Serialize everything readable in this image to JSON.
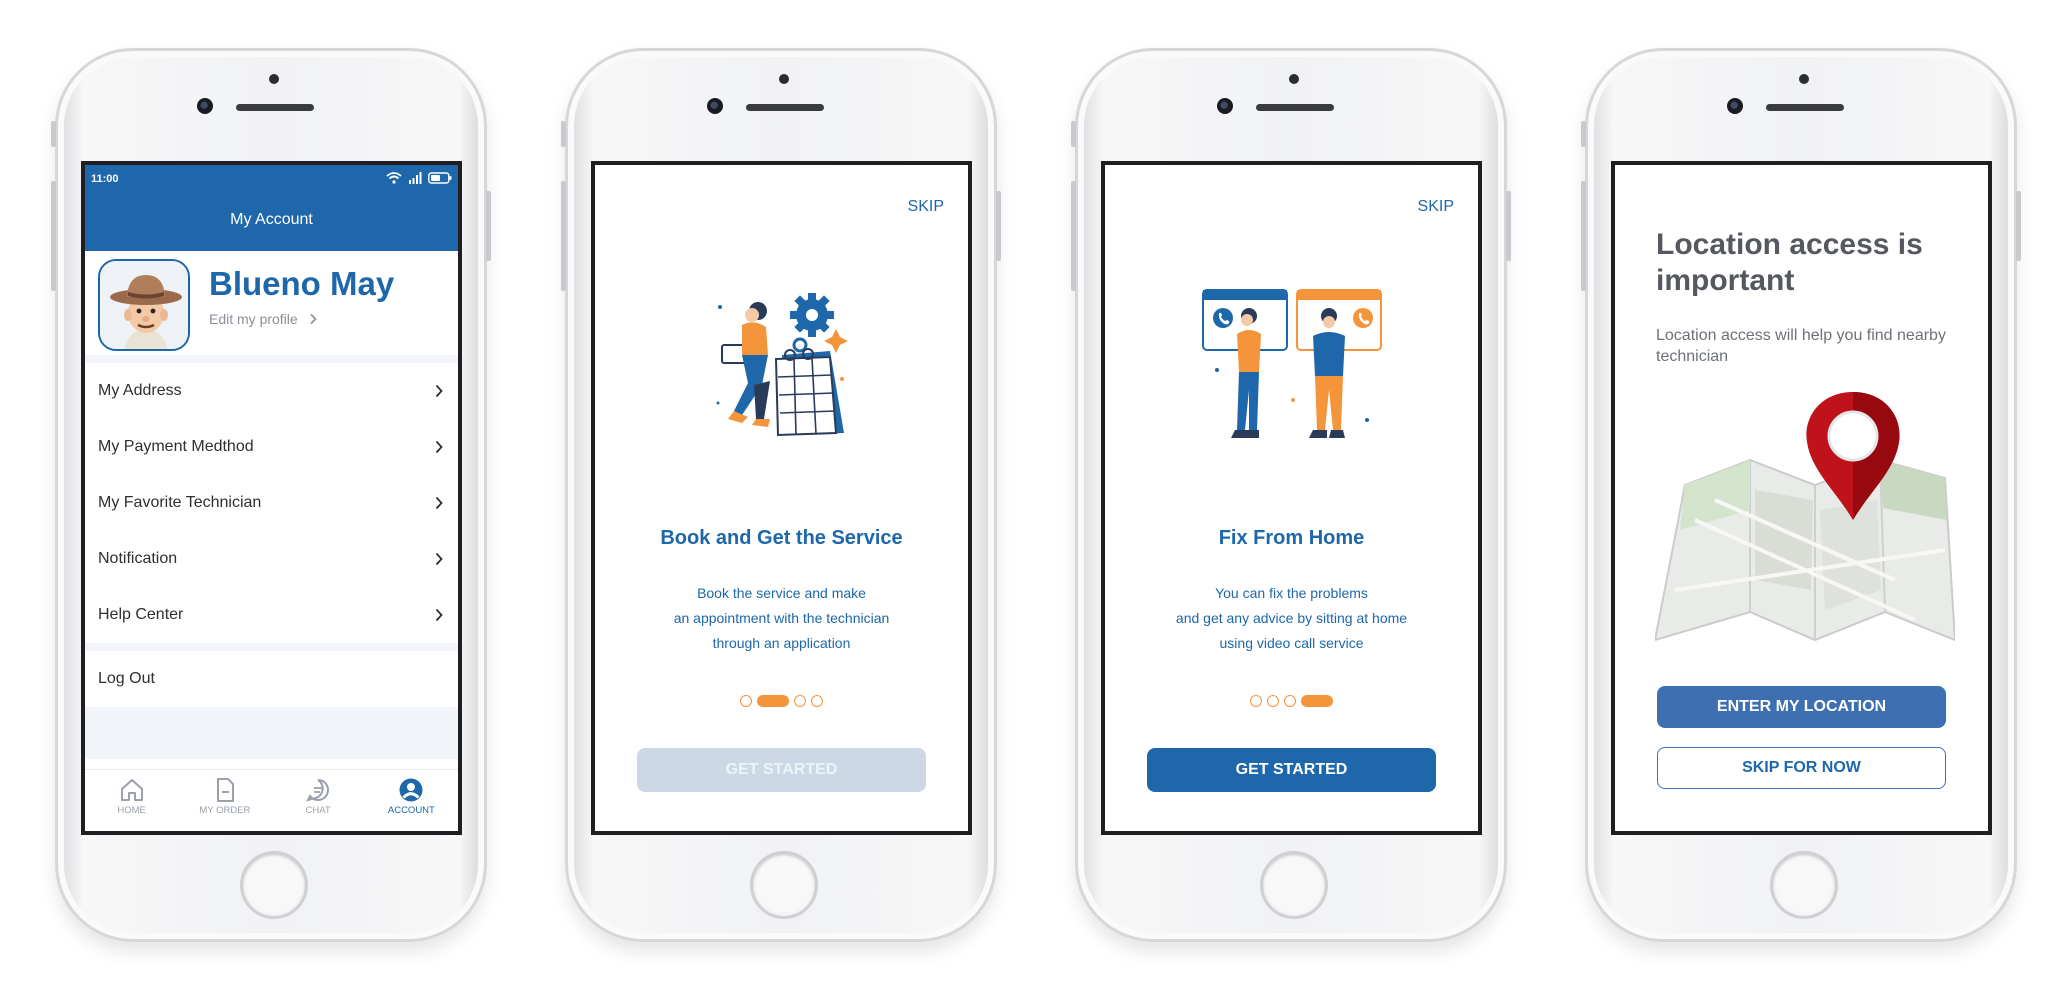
{
  "colors": {
    "primary": "#1d67aa",
    "accent": "#f5953b",
    "disabled": "#ccd8e6"
  },
  "screen_account": {
    "status_time": "11:00",
    "title": "My Account",
    "profile_name": "Blueno May",
    "edit_profile": "Edit my profile",
    "menu": [
      {
        "label": "My Address",
        "icon": "chevron-right-icon"
      },
      {
        "label": "My Payment Medthod",
        "icon": "chevron-right-icon"
      },
      {
        "label": "My Favorite Technician",
        "icon": "chevron-right-icon"
      },
      {
        "label": "Notification",
        "icon": "chevron-right-icon"
      },
      {
        "label": "Help Center",
        "icon": "chevron-right-icon"
      }
    ],
    "logout": "Log Out",
    "tabs": [
      {
        "label": "HOME",
        "icon": "home-icon"
      },
      {
        "label": "MY ORDER",
        "icon": "document-icon"
      },
      {
        "label": "CHAT",
        "icon": "chat-icon"
      },
      {
        "label": "ACCOUNT",
        "icon": "account-icon",
        "active": true
      }
    ]
  },
  "screen_book": {
    "skip": "SKIP",
    "title": "Book and Get the Service",
    "body": [
      "Book the service and make",
      "an appointment with the technician",
      "through an application"
    ],
    "active_page": 2,
    "total_pages": 4,
    "button": "GET STARTED"
  },
  "screen_home": {
    "skip": "SKIP",
    "title": "Fix From Home",
    "body": [
      "You can fix the problems",
      "and get any advice by sitting at home",
      "using video call service"
    ],
    "active_page": 4,
    "total_pages": 4,
    "button": "GET STARTED"
  },
  "screen_location": {
    "title": "Location access is important",
    "subtitle": "Location access will help you find nearby technician",
    "primary_button": "ENTER MY LOCATION",
    "secondary_button": "SKIP FOR NOW"
  }
}
